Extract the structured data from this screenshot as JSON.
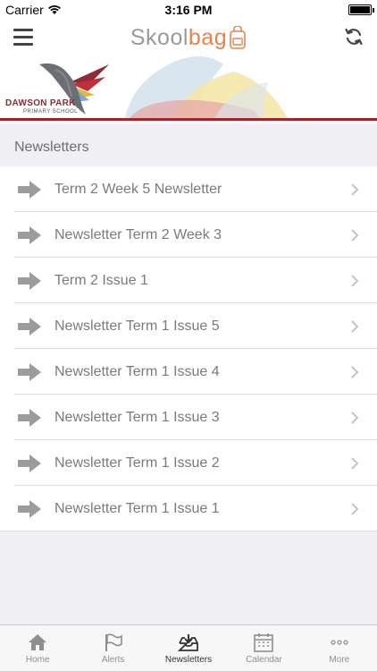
{
  "status_bar": {
    "carrier": "Carrier",
    "time": "3:16 PM"
  },
  "nav": {
    "brand_part1": "Skool",
    "brand_part2": "bag"
  },
  "banner": {
    "school_name": "DAWSON PARK",
    "school_sub": "PRIMARY SCHOOL"
  },
  "section": {
    "title": "Newsletters"
  },
  "newsletters": [
    {
      "label": "Term 2 Week 5 Newsletter"
    },
    {
      "label": "Newsletter Term 2 Week 3"
    },
    {
      "label": "Term 2 Issue 1"
    },
    {
      "label": "Newsletter Term 1 Issue 5"
    },
    {
      "label": "Newsletter Term 1 Issue 4"
    },
    {
      "label": "Newsletter Term 1 Issue 3"
    },
    {
      "label": "Newsletter Term 1 Issue 2"
    },
    {
      "label": "Newsletter Term 1 Issue 1"
    }
  ],
  "tabs": [
    {
      "label": "Home",
      "icon": "home-icon"
    },
    {
      "label": "Alerts",
      "icon": "flag-icon"
    },
    {
      "label": "Newsletters",
      "icon": "inbox-icon"
    },
    {
      "label": "Calendar",
      "icon": "calendar-icon"
    },
    {
      "label": "More",
      "icon": "more-icon"
    }
  ],
  "colors": {
    "accent": "#e8834a",
    "brand_gray": "#9a9a9a",
    "school_red": "#a3232b"
  }
}
